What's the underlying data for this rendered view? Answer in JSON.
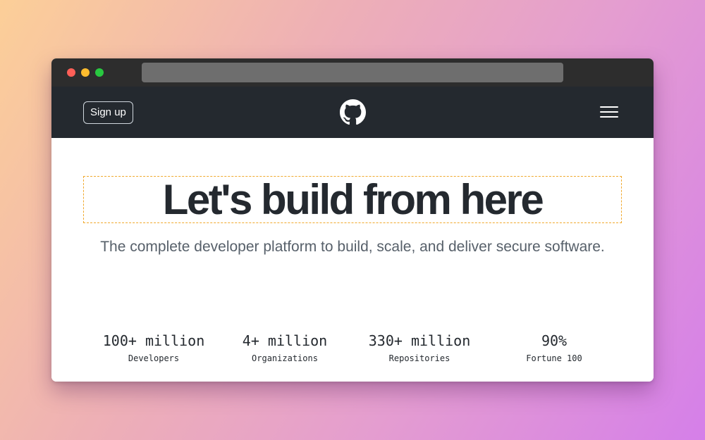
{
  "nav": {
    "signup_label": "Sign up"
  },
  "hero": {
    "headline": "Let's build from here",
    "subtitle": "The complete developer platform to build, scale, and deliver secure software."
  },
  "stats": [
    {
      "value": "100+ million",
      "label": "Developers"
    },
    {
      "value": "4+ million",
      "label": "Organizations"
    },
    {
      "value": "330+ million",
      "label": "Repositories"
    },
    {
      "value": "90%",
      "label": "Fortune 100"
    }
  ],
  "icons": {
    "logo": "github-octocat-icon",
    "menu": "hamburger-menu-icon"
  },
  "colors": {
    "navbar": "#24292f",
    "titlebar": "#2d2d2d",
    "headline": "#24292f",
    "subtitle": "#57606a",
    "highlight_border": "#f0a92e"
  }
}
